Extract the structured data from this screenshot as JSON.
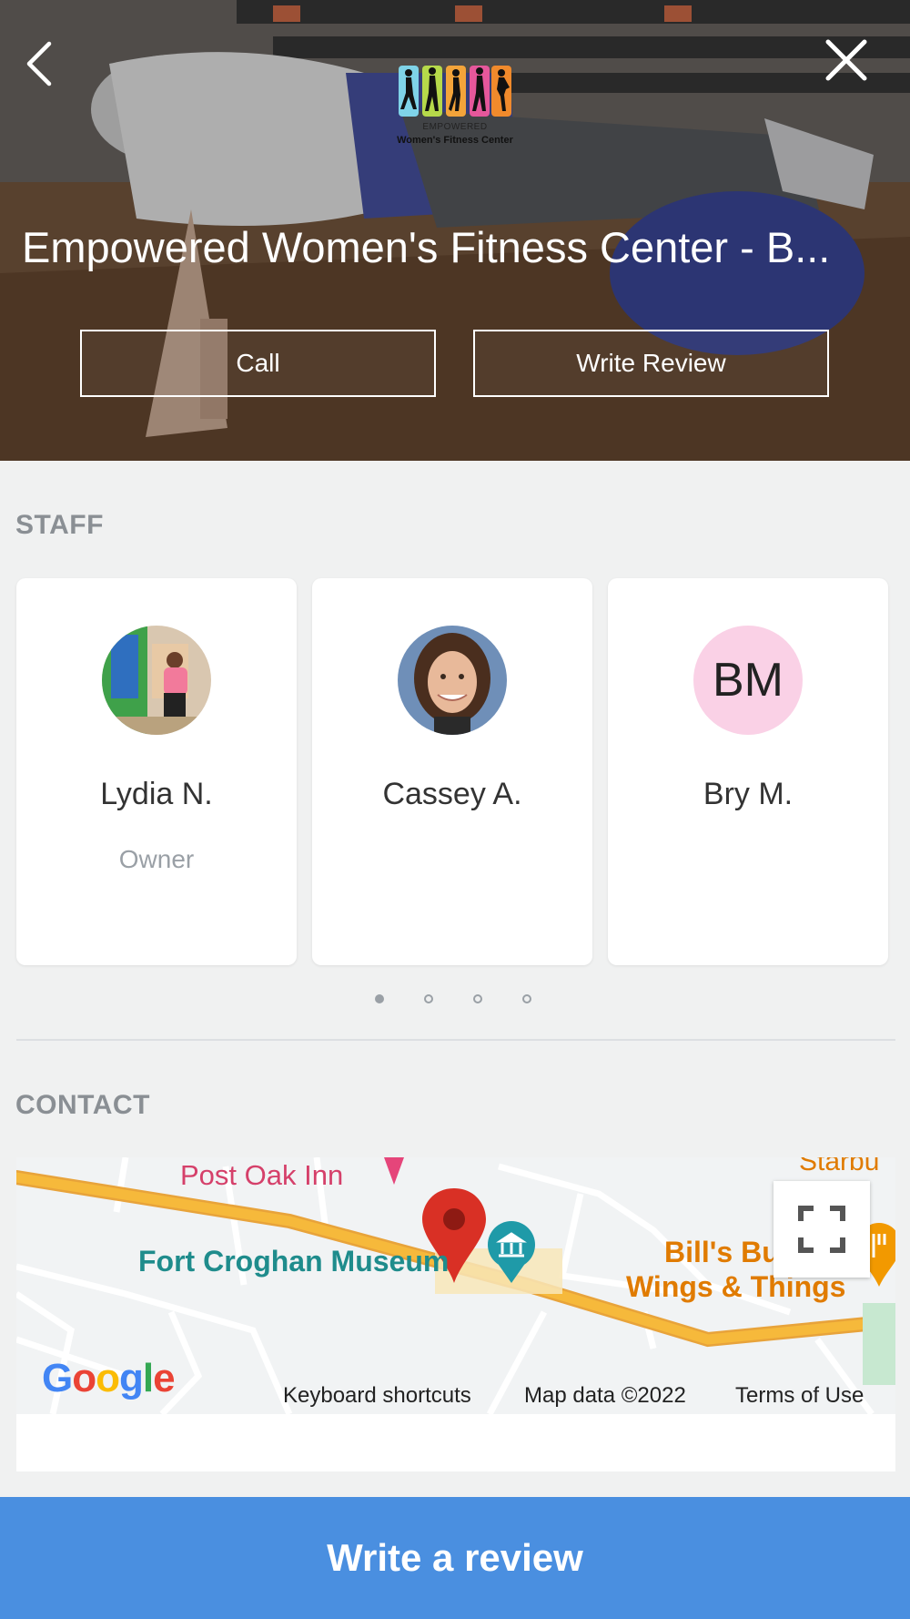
{
  "header": {
    "business_name": "Empowered Women's Fitness Center - B...",
    "logo_line1": "EMPOWERED",
    "logo_line2": "Women's Fitness Center",
    "call_label": "Call",
    "write_review_label": "Write Review",
    "logo_colors": [
      "#7fd3e8",
      "#b6d94a",
      "#f3a43a",
      "#e5579b",
      "#f08a2c"
    ]
  },
  "staff": {
    "section_label": "STAFF",
    "members": [
      {
        "name": "Lydia N.",
        "role": "Owner"
      },
      {
        "name": "Cassey A.",
        "role": ""
      },
      {
        "name": "Bry M.",
        "role": "",
        "initials": "BM"
      }
    ],
    "pagination": {
      "pages": 4,
      "active": 1
    }
  },
  "contact": {
    "section_label": "CONTACT",
    "map": {
      "labels": {
        "post_oak_inn": "Post Oak Inn",
        "fort_croghan": "Fort Croghan Museum",
        "bills_line1": "Bill's Bu",
        "bills_line2": "Wings & Things",
        "starbucks": "Starbu"
      },
      "google_logo": "Google",
      "keyboard_shortcuts": "Keyboard shortcuts",
      "map_data": "Map data ©2022",
      "terms": "Terms of Use"
    }
  },
  "footer": {
    "write_a_review_label": "Write a review"
  },
  "colors": {
    "primary_blue": "#4a8fe0",
    "section_label_gray": "#8a8f94",
    "avatar_pink": "#fad1e6",
    "road_yellow": "#f6b93b",
    "pin_red": "#d93025",
    "museum_teal": "#1f9aa8"
  }
}
